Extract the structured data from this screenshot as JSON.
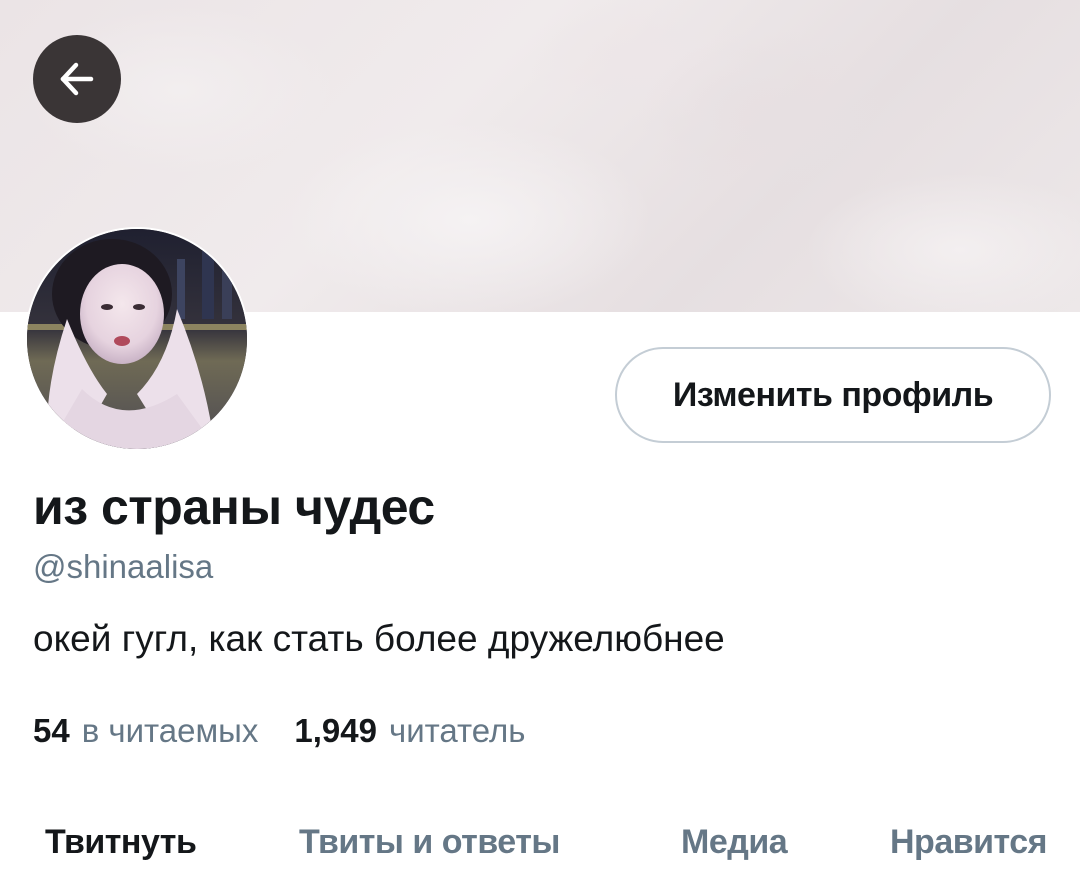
{
  "header": {
    "back_icon": "arrow-left-icon"
  },
  "profile": {
    "edit_button_label": "Изменить профиль",
    "display_name": "из страны чудес",
    "handle": "@shinaalisa",
    "bio": "окей гугл, как стать более дружелюбнее",
    "following_count": "54",
    "following_label": "в читаемых",
    "followers_count": "1,949",
    "followers_label": "читатель"
  },
  "tabs": [
    {
      "label": "Твитнуть",
      "active": true
    },
    {
      "label": "Твиты и ответы",
      "active": false
    },
    {
      "label": "Медиа",
      "active": false
    },
    {
      "label": "Нравится",
      "active": false
    }
  ],
  "colors": {
    "primary_text": "#14171a",
    "secondary_text": "#657786",
    "button_border": "#c4cdd5",
    "back_button_bg": "#3a3536"
  }
}
